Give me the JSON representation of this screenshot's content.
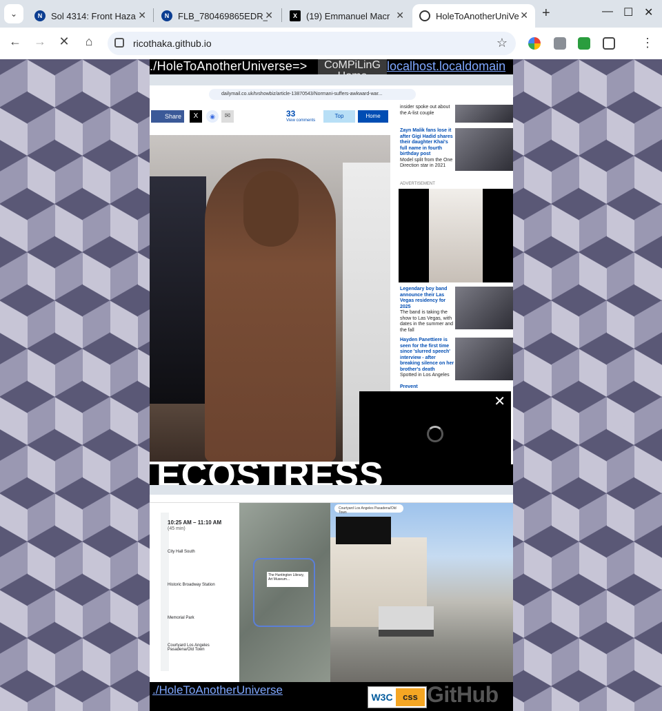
{
  "browser": {
    "tabs": [
      {
        "title": "Sol 4314: Front Haza",
        "favicon": "nasa-icon"
      },
      {
        "title": "FLB_780469865EDR_",
        "favicon": "nasa-icon"
      },
      {
        "title": "(19) Emmanuel Macr",
        "favicon": "x-icon"
      },
      {
        "title": "HoleToAnotherUniVe",
        "favicon": "github-icon",
        "active": true
      }
    ],
    "url": "ricothaka.github.io"
  },
  "page": {
    "home_link": "./HoleToAnotherUniverse=>",
    "compile_line1": "CoMPiLinG",
    "compile_line2": "Home",
    "localhost_link": "localhost.localdomain",
    "embedded_url": "dailymail.co.uk/tvshowbiz/article-13870543/Normani-suffers-awkward-war...",
    "share_label": "Share",
    "comments_count": "33",
    "comments_label": "View comments",
    "top_label": "Top",
    "home_label": "Home",
    "sidebar": [
      {
        "text_plain": "insider spoke out about the A-list couple",
        "headline": ""
      },
      {
        "headline": "Zayn Malik fans lose it after Gigi Hadid shares their daughter Khai's full name in fourth birthday post",
        "text_plain": "Model split from the One Direction star in 2021"
      },
      {
        "headline": "Legendary boy band announce their Las Vegas residency for 2025",
        "text_plain": "The band is taking the show to Las Vegas, with dates in the summer and the fall"
      },
      {
        "headline": "Hayden Panettiere is seen for the first time since 'slurred speech' interview - after breaking silence on her brother's death",
        "text_plain": "Spotted in Los Angeles"
      },
      {
        "headline": "Prevent",
        "text_plain": ""
      }
    ],
    "advert_label": "ADVERTISEMENT",
    "section_title": "ECOSTRESS",
    "directions": {
      "time": "10:25 AM – 11:10 AM",
      "duration": "(45 min)",
      "stops": [
        "City Hall South",
        "Historic Broadway Station",
        "Memorial Park",
        "Courtyard Los Angeles Pasadena/Old Town"
      ]
    },
    "map_popup": "The Huntington Library, Art Museum...",
    "street_search": "Courtyard Los Angeles Pasadena/Old Town",
    "footer_link": "./HoleToAnotherUniverse",
    "w3c_label": "W3C",
    "css_label": "css",
    "github_label": "GitHub"
  }
}
